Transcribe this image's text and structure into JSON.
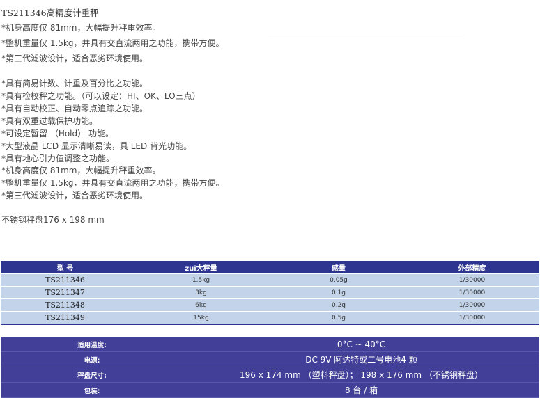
{
  "title": "TS211346高精度计重秤",
  "intro": [
    "*机身高度仅 81mm，大幅提升秤重效率。",
    "*整机重量仅 1.5kg，并具有交直流两用之功能，携带方便。",
    "*第三代滤波设计，适合恶劣环境使用。"
  ],
  "features": [
    "*具有简易计数、计重及百分比之功能。",
    "*具有检校秤之功能。（可以设定：HI、OK、LO三点）",
    "*具有自动校正、自动零点追踪之功能。",
    "*具有双重过载保护功能。",
    "*可设定暂留 （Hold） 功能。",
    "*大型液晶 LCD 显示清晰易读，具 LED 背光功能。",
    "*具有地心引力值调整之功能。",
    "*机身高度仅 81mm，大幅提升秤重效率。",
    "*整机重量仅 1.5kg，并具有交直流两用之功能，携带方便。",
    "*第三代滤波设计，适合恶劣环境使用。"
  ],
  "pan_note": "不锈钢秤盘176 x 198 mm",
  "spec_table": {
    "headers": [
      "型 号",
      "zui大秤量",
      "感量",
      "外部精度"
    ],
    "rows": [
      [
        "TS211346",
        "1.5kg",
        "0.05g",
        "1/30000"
      ],
      [
        "TS211347",
        "3kg",
        "0.1g",
        "1/30000"
      ],
      [
        "TS211348",
        "6kg",
        "0.2g",
        "1/30000"
      ],
      [
        "TS211349",
        "15kg",
        "0.5g",
        "1/30000"
      ]
    ]
  },
  "info_table": [
    {
      "label": "适用温度:",
      "value": "0°C ~ 40°C"
    },
    {
      "label": "电源:",
      "value": "DC 9V 阿达特或二号电池4 颗"
    },
    {
      "label": "秤盘尺寸:",
      "value": "196 x 174 mm （塑料秤盘）； 198 x 176 mm （不锈钢秤盘）"
    },
    {
      "label": "包装:",
      "value": "8 台 / 箱"
    }
  ],
  "colors": {
    "header_bg": "#2e3590",
    "row_bg": "#c3d4ea",
    "info_bg": "#413f97"
  }
}
